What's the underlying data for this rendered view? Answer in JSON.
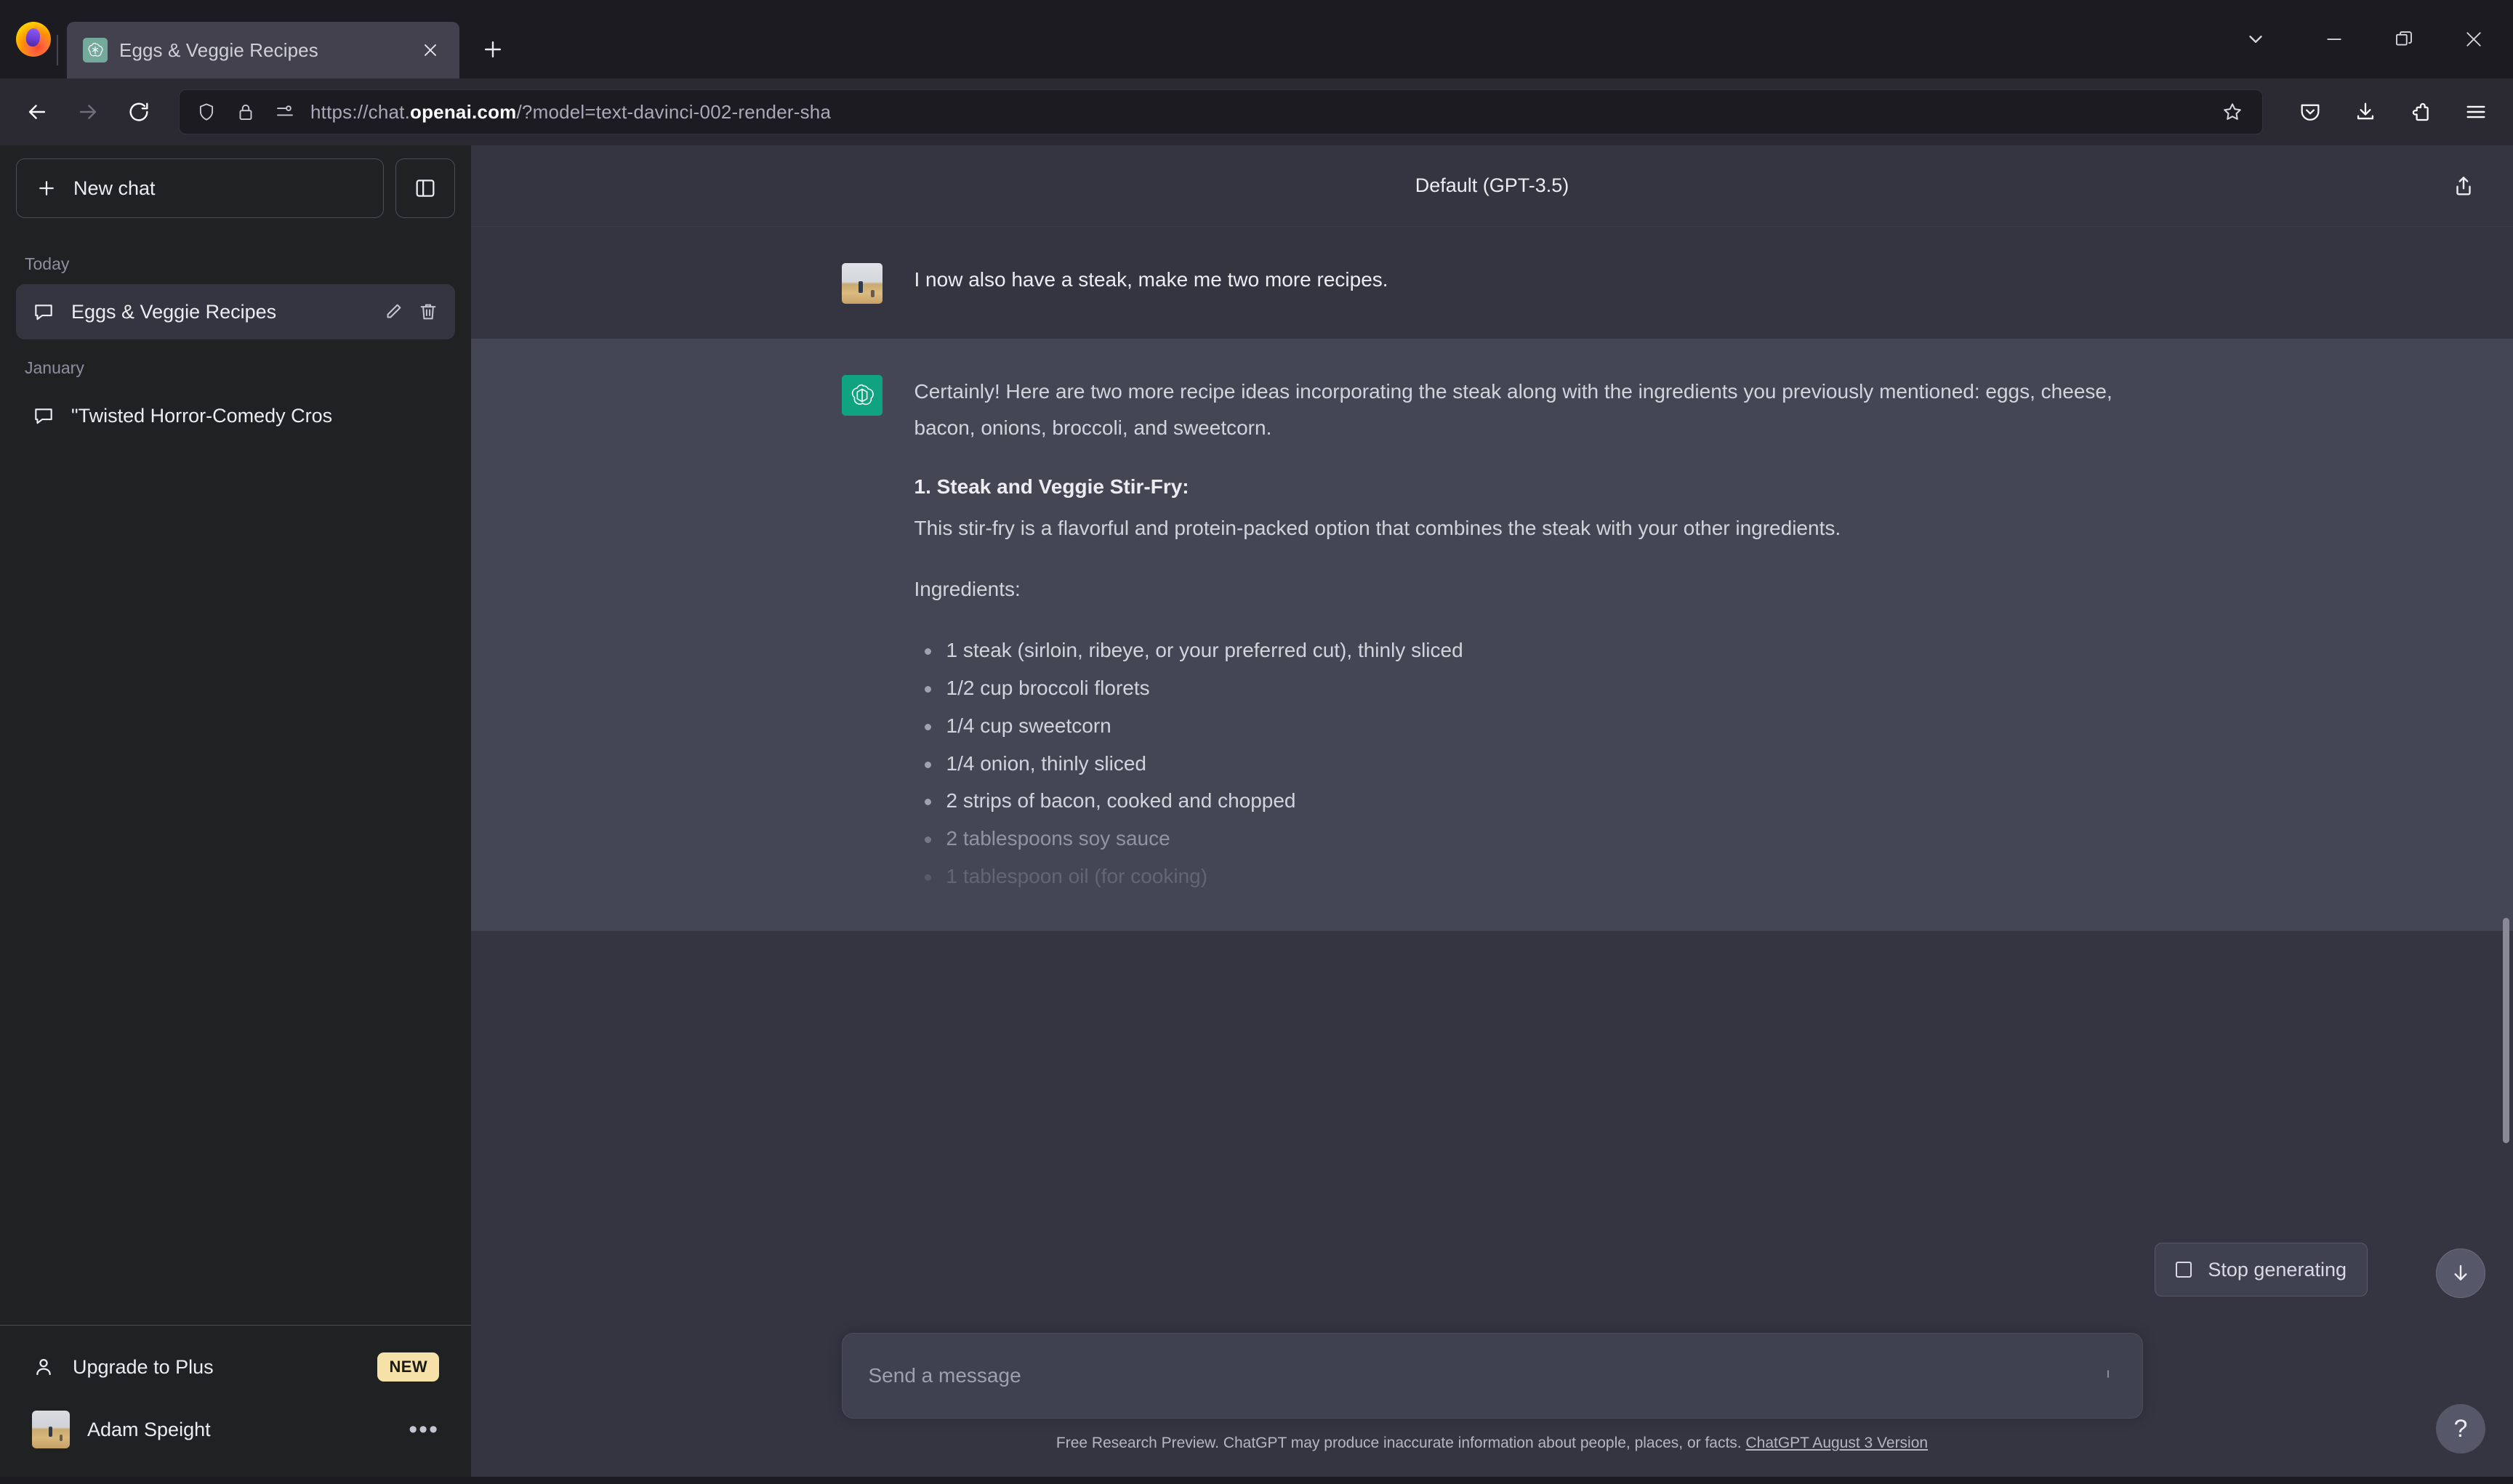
{
  "browser": {
    "tab": {
      "title": "Eggs & Veggie Recipes",
      "favicon_name": "openai-favicon",
      "close_label": "Close tab"
    },
    "new_tab_label": "New tab",
    "url": {
      "prefix": "https://chat.",
      "host": "openai.com",
      "suffix": "/?model=text-davinci-002-render-sha",
      "full": "https://chat.openai.com/?model=text-davinci-002-render-sha"
    },
    "nav": {
      "back": "Back",
      "forward": "Forward",
      "reload": "Reload"
    },
    "url_icons": [
      "shield-icon",
      "lock-icon",
      "permissions-icon"
    ],
    "bookmark_label": "Bookmark this page",
    "toolbar_right": [
      "pocket-icon",
      "downloads-icon",
      "extensions-icon",
      "app-menu-icon"
    ],
    "window_controls": [
      "chevron-down-icon",
      "minimize-icon",
      "restore-icon",
      "close-icon"
    ]
  },
  "sidebar": {
    "new_chat_label": "New chat",
    "collapse_label": "Collapse sidebar",
    "groups": [
      {
        "label": "Today",
        "items": [
          {
            "title": "Eggs & Veggie Recipes",
            "active": true
          }
        ]
      },
      {
        "label": "January",
        "items": [
          {
            "title": "\"Twisted Horror-Comedy Cros",
            "active": false
          }
        ]
      }
    ],
    "upgrade": {
      "label": "Upgrade to Plus",
      "badge": "NEW",
      "badge_color": "#f6e2a9"
    },
    "account": {
      "name": "Adam Speight",
      "menu": "•••"
    }
  },
  "chat": {
    "model_label": "Default (GPT-3.5)",
    "share_label": "Share chat",
    "messages": [
      {
        "role": "user",
        "text": "I now also have a steak, make me two more recipes."
      },
      {
        "role": "assistant",
        "paragraph1": "Certainly! Here are two more recipe ideas incorporating the steak along with the ingredients you previously mentioned: eggs, cheese, bacon, onions, broccoli, and sweetcorn.",
        "heading1": "1. Steak and Veggie Stir-Fry:",
        "paragraph2": "This stir-fry is a flavorful and protein-packed option that combines the steak with your other ingredients.",
        "ingredients_label": "Ingredients:",
        "ingredients": [
          "1 steak (sirloin, ribeye, or your preferred cut), thinly sliced",
          "1/2 cup broccoli florets",
          "1/4 cup sweetcorn",
          "1/4 onion, thinly sliced",
          "2 strips of bacon, cooked and chopped",
          "2 tablespoons soy sauce",
          "1 tablespoon oil (for cooking)"
        ]
      }
    ],
    "stop_generating_label": "Stop generating",
    "scroll_down_label": "Scroll to bottom",
    "help_label": "?"
  },
  "composer": {
    "placeholder": "Send a message",
    "send_label": "Send message"
  },
  "footer": {
    "text": "Free Research Preview. ChatGPT may produce inaccurate information about people, places, or facts. ",
    "link": "ChatGPT August 3 Version"
  },
  "colors": {
    "accent_green": "#10a37f",
    "sidebar_bg": "#202123",
    "chat_bg": "#343541",
    "assistant_bg": "#444654",
    "browser_chrome": "#2b2a33"
  }
}
